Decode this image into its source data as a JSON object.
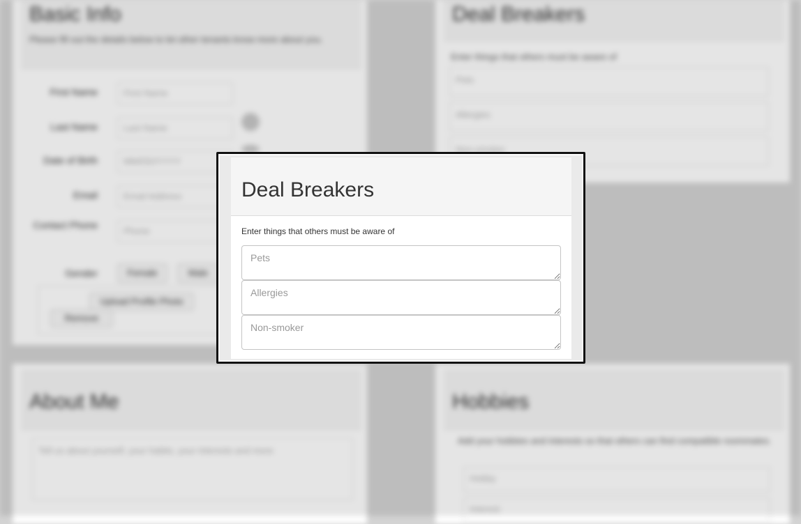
{
  "background": {
    "top_left": {
      "title": "Basic Info",
      "intro": "Please fill out the details below to let other tenants know more about you.",
      "rows": [
        {
          "label": "First Name",
          "value": "First Name"
        },
        {
          "label": "Last Name",
          "value": "Last Name"
        },
        {
          "label": "Date of Birth",
          "value": "MM/DD/YYYY"
        },
        {
          "label": "Email",
          "value": "Email Address"
        },
        {
          "label": "Contact Phone",
          "value": "Phone"
        },
        {
          "label": "Gender",
          "value": ""
        }
      ],
      "gender_options": [
        "Female",
        "Male"
      ],
      "upload_button": "Upload Profile Photo",
      "remove_label": "Remove"
    },
    "top_right": {
      "title": "Deal Breakers",
      "intro": "Enter things that others must be aware of",
      "fields": [
        "Pets",
        "Allergies",
        "Non-smoker"
      ]
    },
    "bottom_left": {
      "title": "About Me",
      "placeholder": "Tell us about yourself, your habits, your interests and more"
    },
    "bottom_right": {
      "title": "Hobbies",
      "intro": "Add your hobbies and interests so that others can find compatible roommates.",
      "fields": [
        "Hobby",
        "Interest"
      ]
    }
  },
  "modal": {
    "title": "Deal Breakers",
    "description": "Enter things that others must be aware of",
    "fields": [
      {
        "placeholder": "Pets"
      },
      {
        "placeholder": "Allergies"
      },
      {
        "placeholder": "Non-smoker"
      }
    ]
  }
}
